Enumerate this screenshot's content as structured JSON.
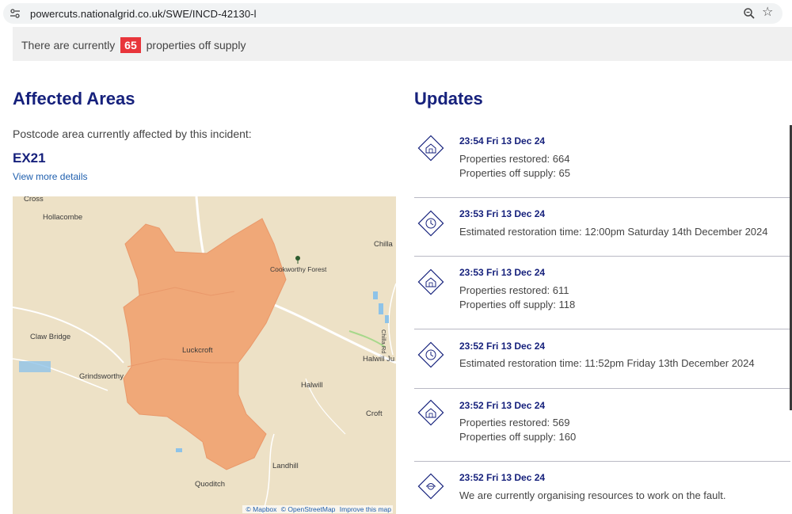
{
  "browser": {
    "url": "powercuts.nationalgrid.co.uk/SWE/INCD-42130-l",
    "icons": [
      "site-settings-icon",
      "zoom-icon",
      "star-icon"
    ]
  },
  "banner": {
    "prefix": "There are currently",
    "count": "65",
    "suffix": "properties off supply",
    "badge_color": "#e8353b"
  },
  "affected": {
    "heading": "Affected Areas",
    "description": "Postcode area currently affected by this incident:",
    "postcode": "EX21",
    "view_more": "View more details"
  },
  "map": {
    "labels": {
      "cross": "Cross",
      "hollacombe": "Hollacombe",
      "chilla": "Chilla",
      "cookworthy": "Cookworthy Forest",
      "claw_bridge": "Claw Bridge",
      "luckcroft": "Luckcroft",
      "grindsworthy": "Grindsworthy",
      "halwill_ju": "Halwill Ju",
      "halwill": "Halwill",
      "croft": "Croft",
      "landhill": "Landhill",
      "quoditch": "Quoditch",
      "chilla_rd": "Chilla Rd"
    },
    "attribution": {
      "mapbox": "© Mapbox",
      "osm": "© OpenStreetMap",
      "improve": "Improve this map"
    },
    "area_color": "#f0a878"
  },
  "updates": {
    "heading": "Updates",
    "items": [
      {
        "icon": "house-icon",
        "time": "23:54 Fri 13 Dec 24",
        "lines": [
          "Properties restored: 664",
          "Properties off supply: 65"
        ]
      },
      {
        "icon": "clock-icon",
        "time": "23:53 Fri 13 Dec 24",
        "lines": [
          "Estimated restoration time: 12:00pm Saturday 14th December 2024"
        ]
      },
      {
        "icon": "house-icon",
        "time": "23:53 Fri 13 Dec 24",
        "lines": [
          "Properties restored: 611",
          "Properties off supply: 118"
        ]
      },
      {
        "icon": "clock-icon",
        "time": "23:52 Fri 13 Dec 24",
        "lines": [
          "Estimated restoration time: 11:52pm Friday 13th December 2024"
        ]
      },
      {
        "icon": "house-icon",
        "time": "23:52 Fri 13 Dec 24",
        "lines": [
          "Properties restored: 569",
          "Properties off supply: 160"
        ]
      },
      {
        "icon": "engineer-icon",
        "time": "23:52 Fri 13 Dec 24",
        "lines": [
          "We are currently organising resources to work on the fault."
        ]
      }
    ]
  }
}
